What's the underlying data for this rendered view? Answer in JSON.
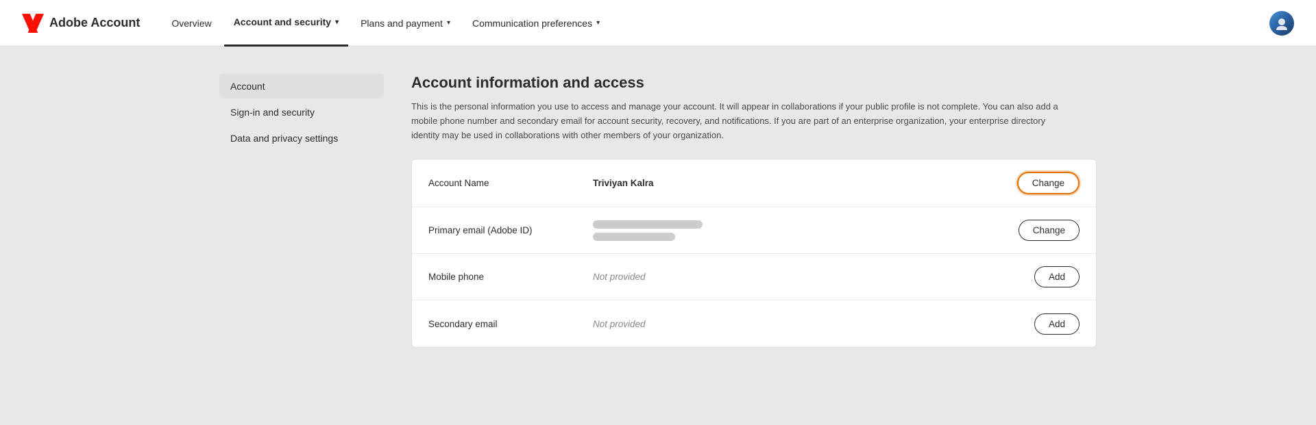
{
  "brand": {
    "name": "Adobe Account"
  },
  "navbar": {
    "items": [
      {
        "id": "overview",
        "label": "Overview",
        "active": false,
        "hasChevron": false
      },
      {
        "id": "account-security",
        "label": "Account and security",
        "active": true,
        "hasChevron": true
      },
      {
        "id": "plans-payment",
        "label": "Plans and payment",
        "active": false,
        "hasChevron": true
      },
      {
        "id": "communication",
        "label": "Communication preferences",
        "active": false,
        "hasChevron": true
      }
    ]
  },
  "sidebar": {
    "items": [
      {
        "id": "account",
        "label": "Account",
        "active": true
      },
      {
        "id": "sign-in-security",
        "label": "Sign-in and security",
        "active": false
      },
      {
        "id": "data-privacy",
        "label": "Data and privacy settings",
        "active": false
      }
    ]
  },
  "main": {
    "title": "Account information and access",
    "description": "This is the personal information you use to access and manage your account. It will appear in collaborations if your public profile is not complete. You can also add a mobile phone number and secondary email for account security, recovery, and notifications. If you are part of an enterprise organization, your enterprise directory identity may be used in collaborations with other members of your organization.",
    "rows": [
      {
        "id": "account-name",
        "label": "Account Name",
        "value": "Triviyan Kalra",
        "valueType": "text",
        "action": "Change",
        "highlighted": true
      },
      {
        "id": "primary-email",
        "label": "Primary email (Adobe ID)",
        "value": "",
        "valueType": "blurred",
        "action": "Change",
        "highlighted": false
      },
      {
        "id": "mobile-phone",
        "label": "Mobile phone",
        "value": "Not provided",
        "valueType": "not-provided",
        "action": "Add",
        "highlighted": false
      },
      {
        "id": "secondary-email",
        "label": "Secondary email",
        "value": "Not provided",
        "valueType": "not-provided",
        "action": "Add",
        "highlighted": false
      }
    ]
  }
}
